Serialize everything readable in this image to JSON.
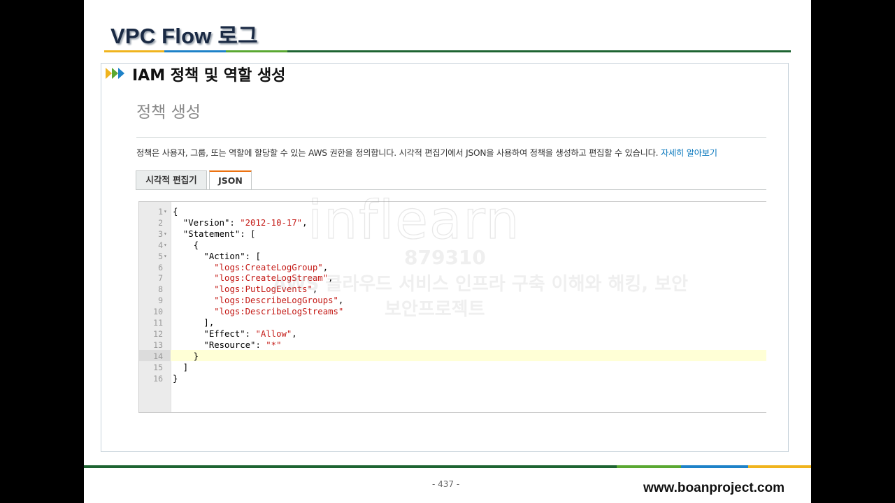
{
  "slide": {
    "title": "VPC Flow 로그",
    "section_heading": "IAM 정책 및 역할 생성",
    "page_number": "- 437 -",
    "site_url": "www.boanproject.com",
    "colors": {
      "rule_yellow": "#f0b41e",
      "rule_blue": "#1e82c8",
      "rule_green": "#5aa832",
      "rule_dark_green": "#1e6432"
    }
  },
  "console": {
    "page_heading": "정책 생성",
    "description": "정책은 사용자, 그룹, 또는 역할에 할당할 수 있는 AWS 권한을 정의합니다. 시각적 편집기에서 JSON을 사용하여 정책을 생성하고 편집할 수 있습니다.",
    "learn_more_link": "자세히 알아보기",
    "tabs": [
      {
        "label": "시각적 편집기",
        "active": false
      },
      {
        "label": "JSON",
        "active": true
      }
    ],
    "active_tab_color": "#ec7211",
    "editor": {
      "active_line": 14,
      "lines": [
        {
          "num": "1",
          "fold": true,
          "text": "{"
        },
        {
          "num": "2",
          "fold": false,
          "key": "  \"Version\": ",
          "value": "\"2012-10-17\"",
          "after": ","
        },
        {
          "num": "3",
          "fold": true,
          "text": "  \"Statement\": ["
        },
        {
          "num": "4",
          "fold": true,
          "text": "    {"
        },
        {
          "num": "5",
          "fold": true,
          "text": "      \"Action\": ["
        },
        {
          "num": "6",
          "fold": false,
          "key": "        ",
          "value": "\"logs:CreateLogGroup\"",
          "after": ","
        },
        {
          "num": "7",
          "fold": false,
          "key": "        ",
          "value": "\"logs:CreateLogStream\"",
          "after": ","
        },
        {
          "num": "8",
          "fold": false,
          "key": "        ",
          "value": "\"logs:PutLogEvents\"",
          "after": ","
        },
        {
          "num": "9",
          "fold": false,
          "key": "        ",
          "value": "\"logs:DescribeLogGroups\"",
          "after": ","
        },
        {
          "num": "10",
          "fold": false,
          "key": "        ",
          "value": "\"logs:DescribeLogStreams\"",
          "after": ""
        },
        {
          "num": "11",
          "fold": false,
          "text": "      ],"
        },
        {
          "num": "12",
          "fold": false,
          "key": "      \"Effect\": ",
          "value": "\"Allow\"",
          "after": ","
        },
        {
          "num": "13",
          "fold": false,
          "key": "      \"Resource\": ",
          "value": "\"*\"",
          "after": ""
        },
        {
          "num": "14",
          "fold": false,
          "text": "    }"
        },
        {
          "num": "15",
          "fold": false,
          "text": "  ]"
        },
        {
          "num": "16",
          "fold": false,
          "text": "}"
        }
      ]
    }
  },
  "watermark": {
    "logo": "inflearn",
    "id": "879310",
    "course": "AWS 클라우드 서비스 인프라 구축 이해와 해킹, 보안",
    "owner": "보안프로젝트"
  }
}
